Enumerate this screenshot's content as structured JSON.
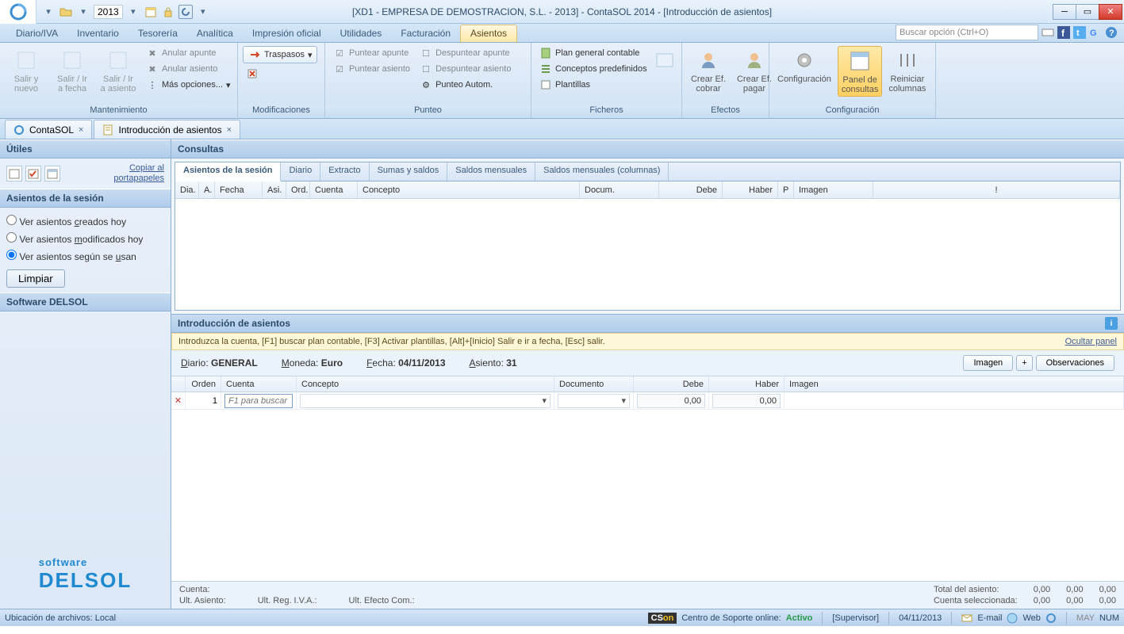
{
  "window": {
    "title": "[XD1 - EMPRESA DE DEMOSTRACION, S.L. - 2013] - ContaSOL 2014 - [Introducción de asientos]",
    "year": "2013"
  },
  "ribbon_tabs": [
    "Diario/IVA",
    "Inventario",
    "Tesorería",
    "Analítica",
    "Impresión oficial",
    "Utilidades",
    "Facturación",
    "Asientos"
  ],
  "active_tab": "Asientos",
  "search_placeholder": "Buscar opción (Ctrl+O)",
  "ribbon": {
    "mantenimiento": {
      "label": "Mantenimiento",
      "big": [
        "Salir y\nnuevo",
        "Salir / Ir\na fecha",
        "Salir / Ir\na asiento"
      ],
      "small": [
        "Anular apunte",
        "Anular asiento",
        "Más opciones..."
      ]
    },
    "modificaciones": {
      "label": "Modificaciones",
      "btn": "Traspasos"
    },
    "punteo": {
      "label": "Punteo",
      "small": [
        "Puntear apunte",
        "Puntear asiento"
      ],
      "small2": [
        "Despuntear apunte",
        "Despuntear asiento",
        "Punteo Autom."
      ]
    },
    "ficheros": {
      "label": "Ficheros",
      "items": [
        "Plan general contable",
        "Conceptos predefinidos",
        "Plantillas"
      ]
    },
    "efectos": {
      "label": "Efectos",
      "btns": [
        "Crear Ef.\ncobrar",
        "Crear Ef.\npagar"
      ]
    },
    "configuracion": {
      "label": "Configuración",
      "btns": [
        "Configuración",
        "Panel de\nconsultas",
        "Reiniciar\ncolumnas"
      ]
    }
  },
  "doc_tabs": [
    {
      "icon": "app-icon",
      "label": "ContaSOL"
    },
    {
      "icon": "doc-icon",
      "label": "Introducción de asientos"
    }
  ],
  "left": {
    "utiles": "Útiles",
    "copiar": "Copiar al\nportapapeles",
    "sesion_hdr": "Asientos de la sesión",
    "radios": [
      {
        "label_pre": "Ver asientos ",
        "ul": "c",
        "label_post": "reados hoy",
        "checked": false
      },
      {
        "label_pre": "Ver asientos ",
        "ul": "m",
        "label_post": "odificados hoy",
        "checked": false
      },
      {
        "label_pre": "Ver asientos según se ",
        "ul": "u",
        "label_post": "san",
        "checked": true
      }
    ],
    "limpiar": "Limpiar",
    "software": "Software DELSOL"
  },
  "consultas": {
    "hdr": "Consultas",
    "tabs": [
      "Asientos de la sesión",
      "Diario",
      "Extracto",
      "Sumas y saldos",
      "Saldos mensuales",
      "Saldos mensuales (columnas)"
    ],
    "cols": [
      "Dia.",
      "A.",
      "Fecha",
      "Asi.",
      "Ord.",
      "Cuenta",
      "Concepto",
      "Docum.",
      "Debe",
      "Haber",
      "P",
      "Imagen",
      "!"
    ]
  },
  "intro": {
    "hdr": "Introducción de asientos",
    "hint": "Introduzca la cuenta, [F1] buscar plan contable, [F3] Activar plantillas, [Alt]+[Inicio] Salir e ir a fecha, [Esc] salir.",
    "ocultar": "Ocultar panel",
    "meta": {
      "diario_l": "Diario:",
      "diario_v": "GENERAL",
      "moneda_l": "Moneda:",
      "moneda_v": "Euro",
      "fecha_l": "Fecha:",
      "fecha_v": "04/11/2013",
      "asiento_l": "Asiento:",
      "asiento_v": "31",
      "imagen": "Imagen",
      "plus": "+",
      "obs": "Observaciones"
    },
    "cols": [
      "Orden",
      "Cuenta",
      "Concepto",
      "Documento",
      "Debe",
      "Haber",
      "Imagen"
    ],
    "row": {
      "orden": "1",
      "cuenta_ph": "F1 para buscar",
      "debe": "0,00",
      "haber": "0,00"
    }
  },
  "footer": {
    "cuenta": "Cuenta:",
    "ult_asiento": "Ult. Asiento:",
    "ult_reg": "Ult. Reg. I.V.A.:",
    "ult_efecto": "Ult. Efecto Com.:",
    "total": "Total del asiento:",
    "cuenta_sel": "Cuenta seleccionada:",
    "zeros": "0,00"
  },
  "status": {
    "ubicacion": "Ubicación de archivos: Local",
    "centro": "Centro de Soporte online:",
    "activo": "Activo",
    "supervisor": "[Supervisor]",
    "fecha": "04/11/2013",
    "email": "E-mail",
    "web": "Web",
    "may": "MAY",
    "num": "NUM"
  }
}
